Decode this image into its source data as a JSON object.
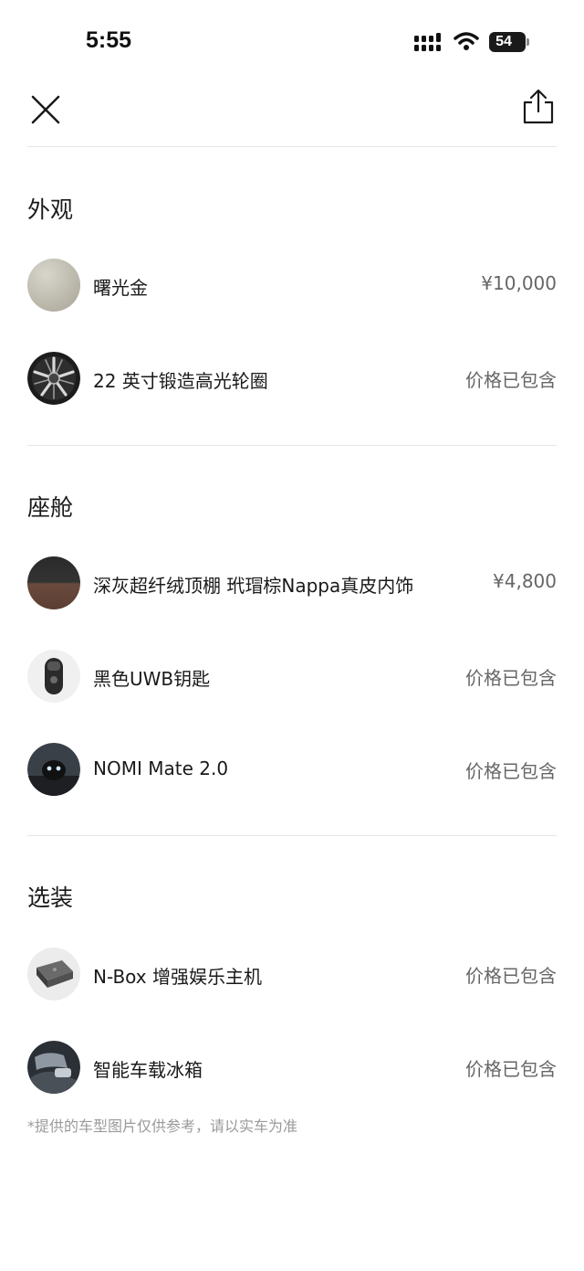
{
  "status_bar": {
    "time": "5:55",
    "battery": "54"
  },
  "toolbar": {
    "close_icon": "close-icon",
    "share_icon": "share-icon"
  },
  "sections": [
    {
      "title": "外观",
      "items": [
        {
          "name": "曙光金",
          "price": "¥10,000",
          "thumb": "gold-paint-swatch"
        },
        {
          "name": "22 英寸锻造高光轮圈",
          "price": "价格已包含",
          "thumb": "wheel-rim"
        }
      ]
    },
    {
      "title": "座舱",
      "items": [
        {
          "name": "深灰超纤绒顶棚 玳瑁棕Nappa真皮内饰",
          "price": "¥4,800",
          "thumb": "interior-swatch"
        },
        {
          "name": "黑色UWB钥匙",
          "price": "价格已包含",
          "thumb": "uwb-key"
        },
        {
          "name": "NOMI Mate 2.0",
          "price": "价格已包含",
          "thumb": "nomi-robot"
        }
      ]
    },
    {
      "title": "选装",
      "items": [
        {
          "name": "N-Box 增强娱乐主机",
          "price": "价格已包含",
          "thumb": "n-box-console"
        },
        {
          "name": "智能车载冰箱",
          "price": "价格已包含",
          "thumb": "car-fridge"
        }
      ]
    }
  ],
  "footnote": "*提供的车型图片仅供参考，请以实车为准",
  "colors": {
    "text": "#1a1a1a",
    "price": "#666666",
    "divider": "#e6e6e6",
    "footnote": "#9a9a9a"
  }
}
